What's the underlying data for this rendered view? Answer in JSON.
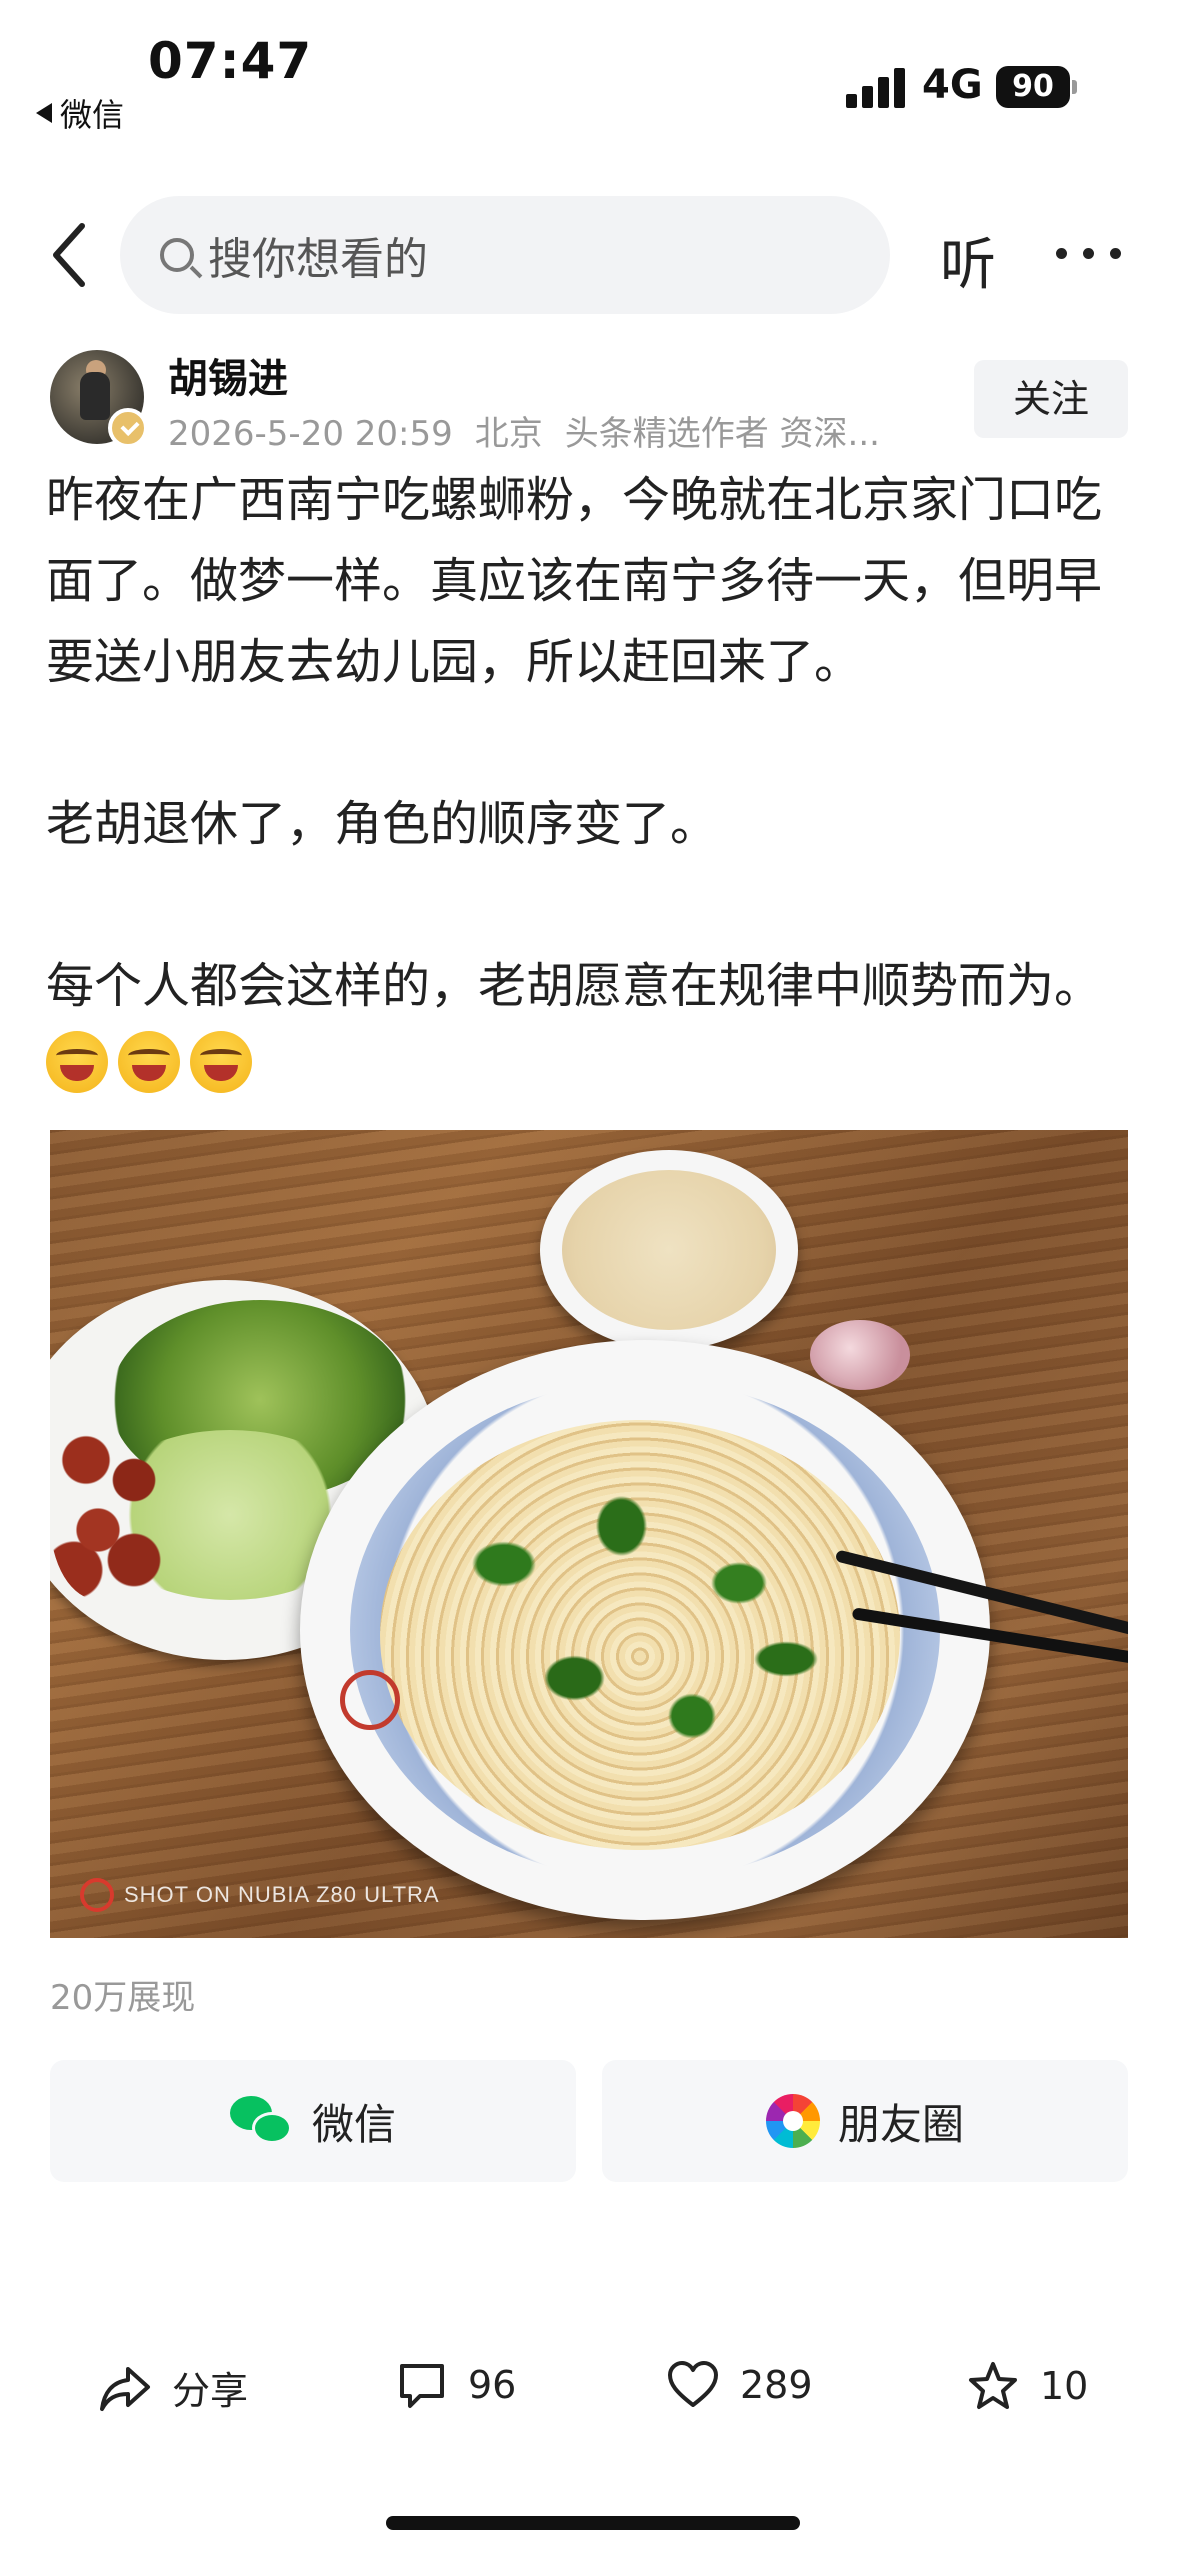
{
  "status_bar": {
    "time": "07:47",
    "back_app": "微信",
    "network": "4G",
    "battery": "90"
  },
  "nav": {
    "search_placeholder": "搜你想看的",
    "listen_label": "听"
  },
  "author": {
    "name": "胡锡进",
    "datetime": "2026-5-20 20:59",
    "location": "北京",
    "title": "头条精选作者 资深...",
    "follow_label": "关注"
  },
  "post": {
    "paragraphs": [
      "昨夜在广西南宁吃螺蛳粉，今晚就在北京家门口吃面了。做梦一样。真应该在南宁多待一天，但明早要送小朋友去幼儿园，所以赶回来了。",
      "老胡退休了，角色的顺序变了。",
      "每个人都会这样的，老胡愿意在规律中顺势而为。"
    ],
    "photo_watermark": "SHOT ON NUBIA Z80 ULTRA",
    "views": "20万展现"
  },
  "share": {
    "wechat_label": "微信",
    "moments_label": "朋友圈"
  },
  "actions": {
    "share_label": "分享",
    "comments": "96",
    "likes": "289",
    "favorites": "10"
  },
  "colors": {
    "wechat_green": "#07c160",
    "meta_gray": "#999999",
    "button_bg": "#f2f3f5"
  }
}
